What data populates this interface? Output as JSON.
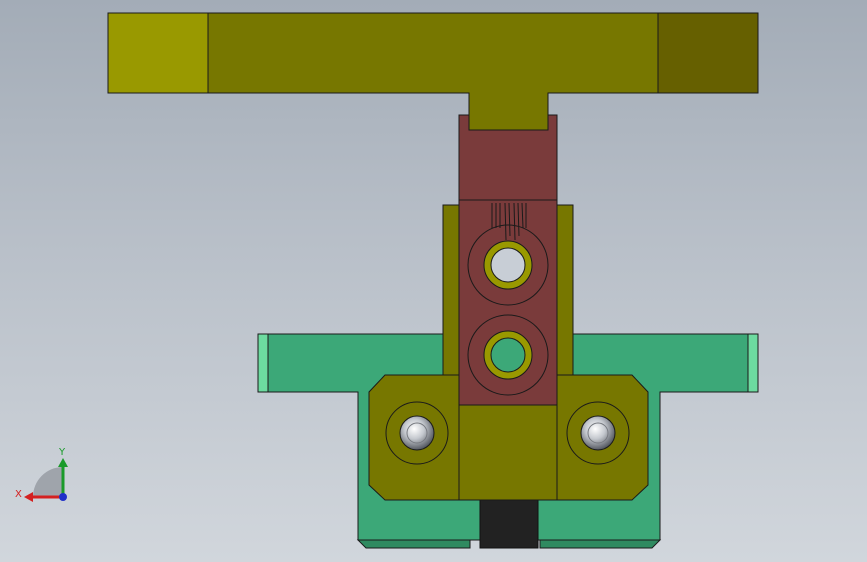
{
  "viewport": {
    "kind": "cad-3d-viewport",
    "view": "front"
  },
  "triad": {
    "x_label": "X",
    "y_label": "Y",
    "x_color": "#d42020",
    "y_color": "#1a9a2a",
    "z_color": "#2030c8"
  },
  "colors": {
    "olive_part": "#777700",
    "olive_light": "#999900",
    "olive_dark": "#666000",
    "brown_part": "#7a3b3b",
    "green_part": "#3ca878",
    "green_light": "#6ddba0",
    "black_part": "#222222",
    "edge": "#1a1a1a"
  }
}
